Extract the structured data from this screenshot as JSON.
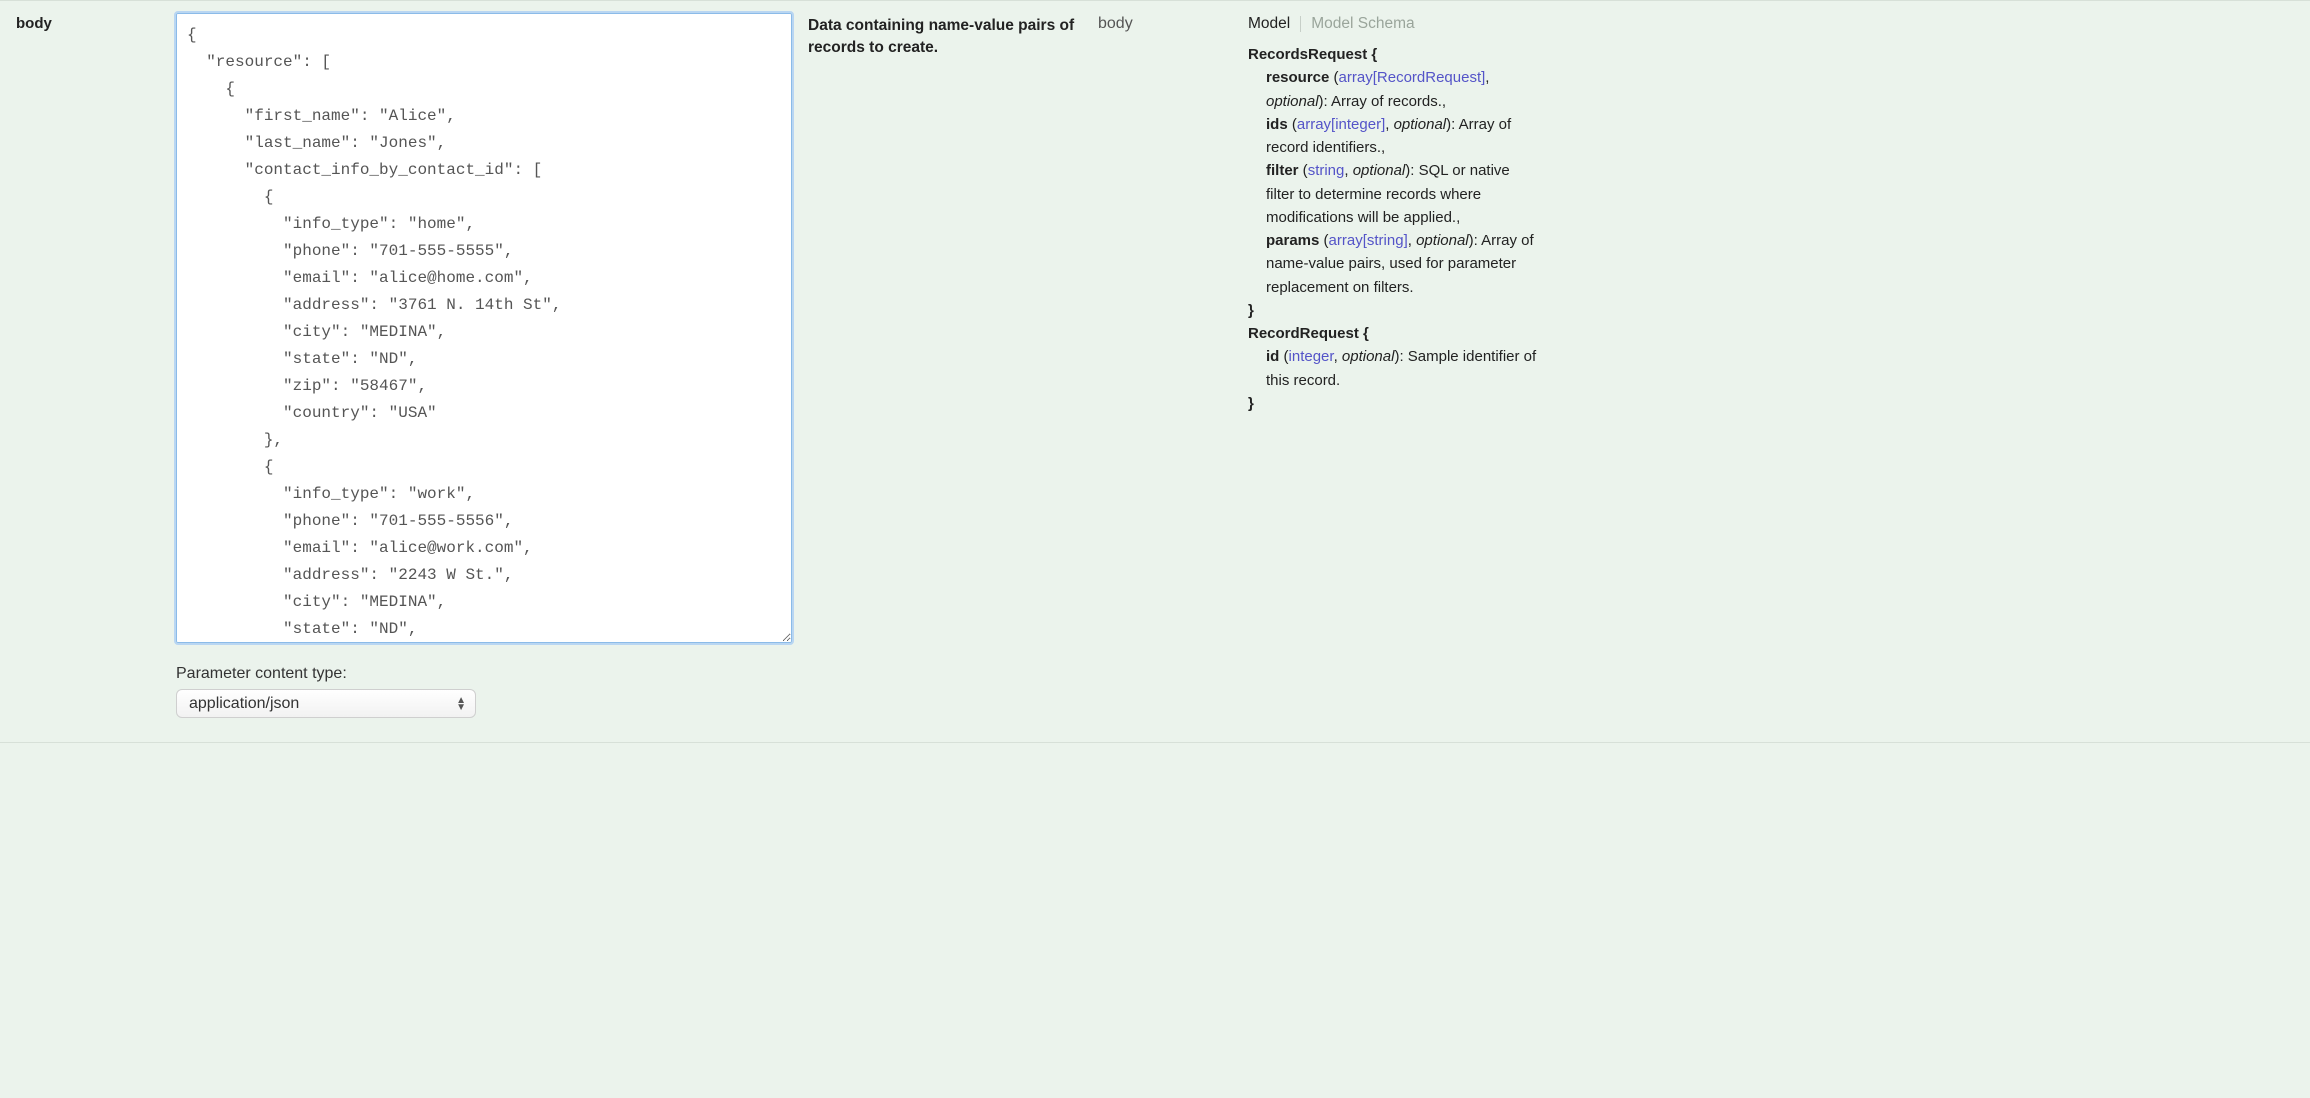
{
  "param": {
    "name": "body",
    "description": "Data containing name-value pairs of records to create.",
    "location": "body"
  },
  "body_value": "{\n  \"resource\": [\n    {\n      \"first_name\": \"Alice\",\n      \"last_name\": \"Jones\",\n      \"contact_info_by_contact_id\": [\n        {\n          \"info_type\": \"home\",\n          \"phone\": \"701-555-5555\",\n          \"email\": \"alice@home.com\",\n          \"address\": \"3761 N. 14th St\",\n          \"city\": \"MEDINA\",\n          \"state\": \"ND\",\n          \"zip\": \"58467\",\n          \"country\": \"USA\"\n        },\n        {\n          \"info_type\": \"work\",\n          \"phone\": \"701-555-5556\",\n          \"email\": \"alice@work.com\",\n          \"address\": \"2243 W St.\",\n          \"city\": \"MEDINA\",\n          \"state\": \"ND\",",
  "content_type": {
    "label": "Parameter content type:",
    "selected": "application/json"
  },
  "tabs": {
    "model": "Model",
    "schema": "Model Schema"
  },
  "model": {
    "records_request": {
      "title": "RecordsRequest {",
      "close": "}",
      "resource": {
        "name": "resource",
        "lparen": " (",
        "type": "array[RecordRequest]",
        "sep": ", ",
        "opt": "optional",
        "rparen_desc": "): Array of records.,"
      },
      "ids": {
        "name": "ids",
        "lparen": " (",
        "type": "array[integer]",
        "sep": ", ",
        "opt": "optional",
        "rparen_desc": "): Array of record identifiers.,"
      },
      "filter": {
        "name": "filter",
        "lparen": " (",
        "type": "string",
        "sep": ", ",
        "opt": "optional",
        "rparen_desc": "): SQL or native filter to determine records where modifications will be applied.,"
      },
      "params": {
        "name": "params",
        "lparen": " (",
        "type": "array[string]",
        "sep": ", ",
        "opt": "optional",
        "rparen_desc": "): Array of name-value pairs, used for parameter replacement on filters."
      }
    },
    "record_request": {
      "title": "RecordRequest {",
      "close": "}",
      "id": {
        "name": "id",
        "lparen": " (",
        "type": "integer",
        "sep": ", ",
        "opt": "optional",
        "rparen_desc": "): Sample identifier of this record."
      }
    }
  }
}
